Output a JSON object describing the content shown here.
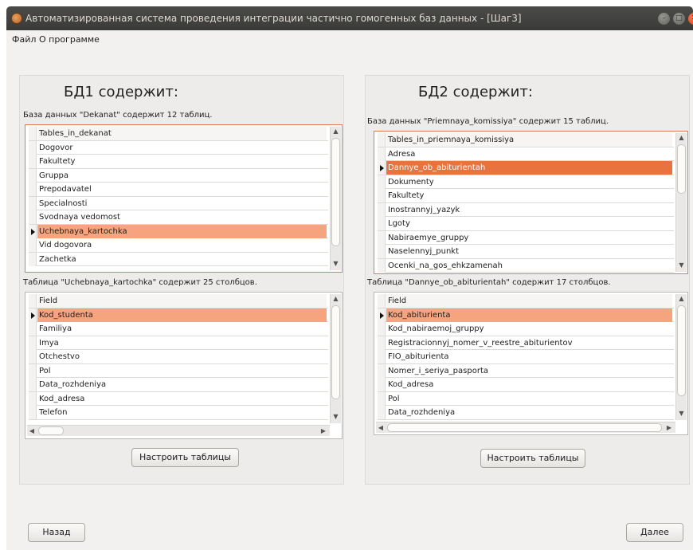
{
  "window": {
    "title": "Автоматизированная система проведения интеграции частично гомогенных баз данных - [Шаг3]"
  },
  "menu": {
    "file": "Файл",
    "about": "О программе"
  },
  "db1": {
    "heading": "БД1 содержит:",
    "tables_caption": "База данных \"Dekanat\" содержит 12 таблиц.",
    "tables_header": "Tables_in_dekanat",
    "tables": [
      "Dogovor",
      "Fakultety",
      "Gruppa",
      "Prepodavatel",
      "Specialnosti",
      "Svodnaya vedomost",
      "Uchebnaya_kartochka",
      "Vid dogovora",
      "Zachetka"
    ],
    "selected_table_index": 6,
    "columns_caption": "Таблица \"Uchebnaya_kartochka\" содержит 25 столбцов.",
    "columns_header": "Field",
    "columns": [
      "Kod_studenta",
      "Familiya",
      "Imya",
      "Otchestvo",
      "Pol",
      "Data_rozhdeniya",
      "Kod_adresa",
      "Telefon"
    ],
    "selected_column_index": 0,
    "configure_button": "Настроить таблицы"
  },
  "db2": {
    "heading": "БД2 содержит:",
    "tables_caption": "База данных \"Priemnaya_komissiya\" содержит 15 таблиц.",
    "tables_header": "Tables_in_priemnaya_komissiya",
    "tables": [
      "Adresa",
      "Dannye_ob_abiturientah",
      "Dokumenty",
      "Fakultety",
      "Inostrannyj_yazyk",
      "Lgoty",
      "Nabiraemye_gruppy",
      "Naselennyj_punkt",
      "Ocenki_na_gos_ehkzamenah"
    ],
    "selected_table_index": 1,
    "columns_caption": "Таблица \"Dannye_ob_abiturientah\" содержит 17 столбцов.",
    "columns_header": "Field",
    "columns": [
      "Kod_abiturienta",
      "Kod_nabiraemoj_gruppy",
      "Registracionnyj_nomer_v_reestre_abiturientov",
      "FIO_abiturienta",
      "Nomer_i_seriya_pasporta",
      "Kod_adresa",
      "Pol",
      "Data_rozhdeniya"
    ],
    "selected_column_index": 0,
    "configure_button": "Настроить таблицы"
  },
  "nav": {
    "back": "Назад",
    "next": "Далее"
  },
  "colors": {
    "selection": "#f6a47d",
    "selection_strong": "#e9733f",
    "titlebar": "#3c3c3a",
    "frame_accent": "#e07b50"
  }
}
